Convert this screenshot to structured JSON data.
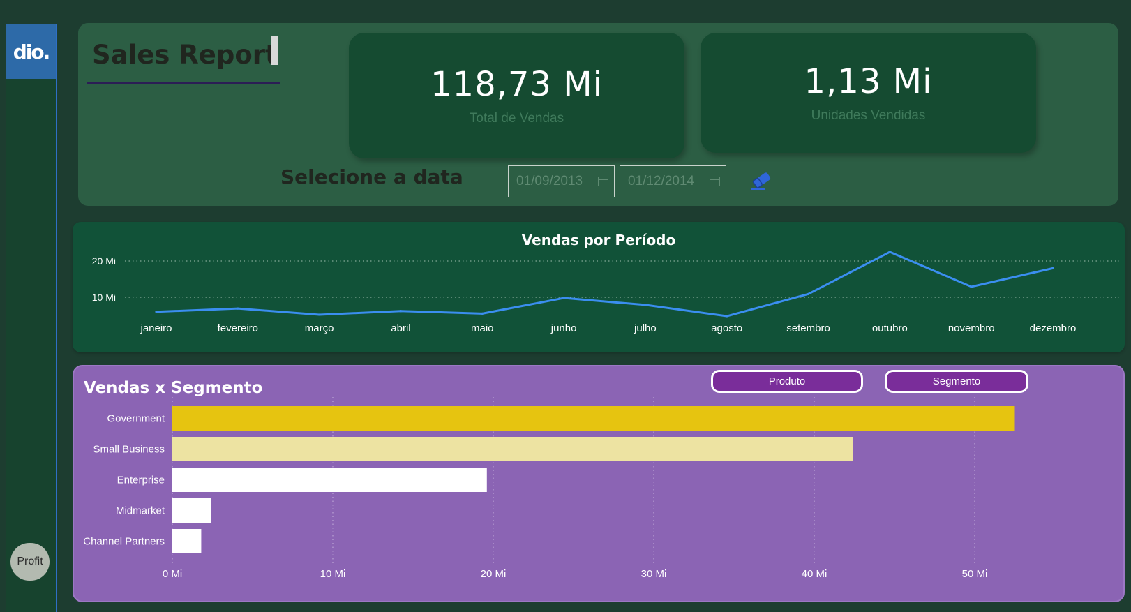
{
  "sidebar": {
    "logo_text": "dio.",
    "profit_button": "Profit"
  },
  "header": {
    "title": "Sales Report",
    "kpis": [
      {
        "value": "118,73 Mi",
        "label": "Total de Vendas"
      },
      {
        "value": "1,13 Mi",
        "label": "Unidades Vendidas"
      }
    ],
    "date_filter": {
      "label": "Selecione a data",
      "start": "01/09/2013",
      "end": "01/12/2014"
    }
  },
  "colors": {
    "line": "#3b8ef0",
    "bar_government": "#e6c410",
    "bar_small_business": "#ede3a2",
    "bar_other": "#ffffff",
    "eraser_icon": "#2f66d8"
  },
  "chart_data": [
    {
      "type": "line",
      "title": "Vendas por Período",
      "categories": [
        "janeiro",
        "fevereiro",
        "março",
        "abril",
        "maio",
        "junho",
        "julho",
        "agosto",
        "setembro",
        "outubro",
        "novembro",
        "dezembro"
      ],
      "series": [
        {
          "values": [
            6.0,
            6.9,
            5.2,
            6.2,
            5.5,
            9.8,
            7.9,
            4.8,
            10.9,
            22.5,
            12.9,
            18.0
          ]
        }
      ],
      "y_ticks": [
        {
          "value": 10,
          "label": "10 Mi"
        },
        {
          "value": 20,
          "label": "20 Mi"
        }
      ],
      "ylim": [
        0,
        25
      ],
      "grid": "dotted horizontal"
    },
    {
      "type": "bar",
      "orientation": "horizontal",
      "title": "Vendas x Segmento",
      "buttons": [
        "Produto",
        "Segmento"
      ],
      "categories": [
        "Government",
        "Small Business",
        "Enterprise",
        "Midmarket",
        "Channel Partners"
      ],
      "values": [
        52.5,
        42.4,
        19.6,
        2.4,
        1.8
      ],
      "x_ticks": [
        {
          "value": 0,
          "label": "0 Mi"
        },
        {
          "value": 10,
          "label": "10 Mi"
        },
        {
          "value": 20,
          "label": "20 Mi"
        },
        {
          "value": 30,
          "label": "30 Mi"
        },
        {
          "value": 40,
          "label": "40 Mi"
        },
        {
          "value": 50,
          "label": "50 Mi"
        }
      ],
      "xlim": [
        0,
        50
      ],
      "grid": "dotted vertical"
    }
  ]
}
